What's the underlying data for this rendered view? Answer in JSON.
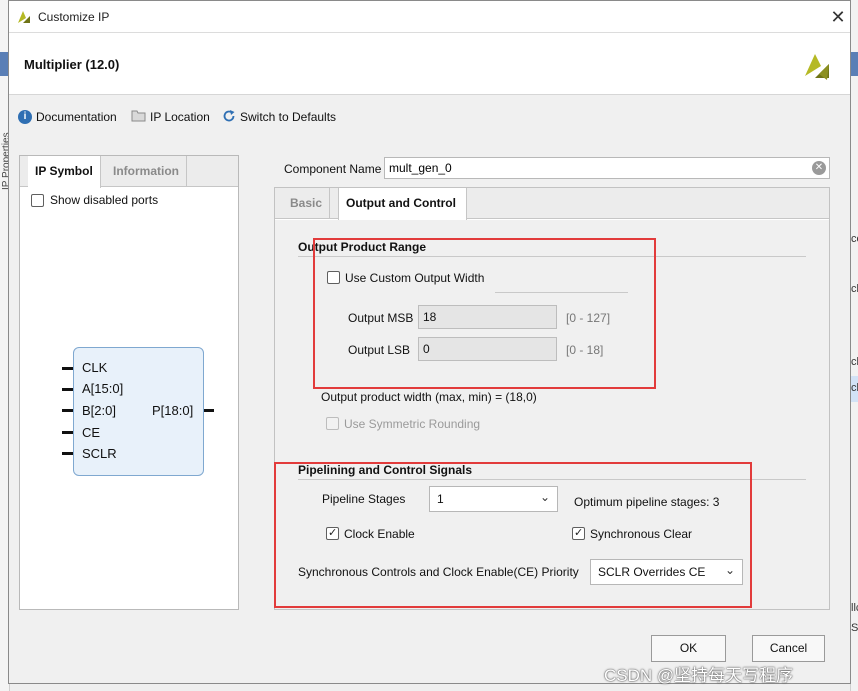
{
  "window": {
    "title": "Customize IP",
    "header_title": "Multiplier (12.0)"
  },
  "toolbar": {
    "documentation": "Documentation",
    "ip_location": "IP Location",
    "switch_defaults": "Switch to Defaults"
  },
  "left_panel": {
    "tabs": [
      {
        "label": "IP Symbol",
        "active": true
      },
      {
        "label": "Information",
        "active": false
      }
    ],
    "show_disabled_ports": {
      "label": "Show disabled ports",
      "checked": false
    },
    "symbol": {
      "left_pins": [
        "CLK",
        "A[15:0]",
        "B[2:0]",
        "CE",
        "SCLR"
      ],
      "right_pins": [
        "P[18:0]"
      ]
    }
  },
  "component_name": {
    "label": "Component Name",
    "value": "mult_gen_0"
  },
  "right_tabs": [
    {
      "label": "Basic",
      "active": false
    },
    {
      "label": "Output and Control",
      "active": true
    }
  ],
  "output_product_range": {
    "title": "Output Product Range",
    "use_custom_width": {
      "label": "Use Custom Output Width",
      "checked": false
    },
    "msb": {
      "label": "Output MSB",
      "value": "18",
      "range": "[0 - 127]"
    },
    "lsb": {
      "label": "Output LSB",
      "value": "0",
      "range": "[0 - 18]"
    },
    "width_note": "Output product width (max, min) = (18,0)",
    "symmetric_rounding": {
      "label": "Use Symmetric Rounding",
      "checked": false,
      "disabled": true
    }
  },
  "pipelining": {
    "title": "Pipelining and Control Signals",
    "pipeline_stages": {
      "label": "Pipeline Stages",
      "value": "1"
    },
    "optimum_note": "Optimum pipeline stages: 3",
    "clock_enable": {
      "label": "Clock Enable",
      "checked": true
    },
    "synchronous_clear": {
      "label": "Synchronous Clear",
      "checked": true
    },
    "priority": {
      "label": "Synchronous Controls and Clock Enable(CE) Priority",
      "value": "SCLR Overrides CE"
    }
  },
  "buttons": {
    "ok": "OK",
    "cancel": "Cancel"
  },
  "background": {
    "left_vertical_text": "IP Properties",
    "right_fragments": [
      "ce",
      "clu",
      "clu",
      "clu",
      "llc",
      "S"
    ]
  },
  "watermark": "CSDN @坚持每天写程序",
  "colors": {
    "highlight_box": "#e23b3b",
    "symbol_fill": "#e8f1fa",
    "info_icon": "#2f6fb3",
    "logo": "#b5b924"
  },
  "icons": [
    "xilinx-logo-icon",
    "info-icon",
    "folder-icon",
    "refresh-icon",
    "close-icon",
    "clear-icon",
    "chevron-down-icon"
  ]
}
